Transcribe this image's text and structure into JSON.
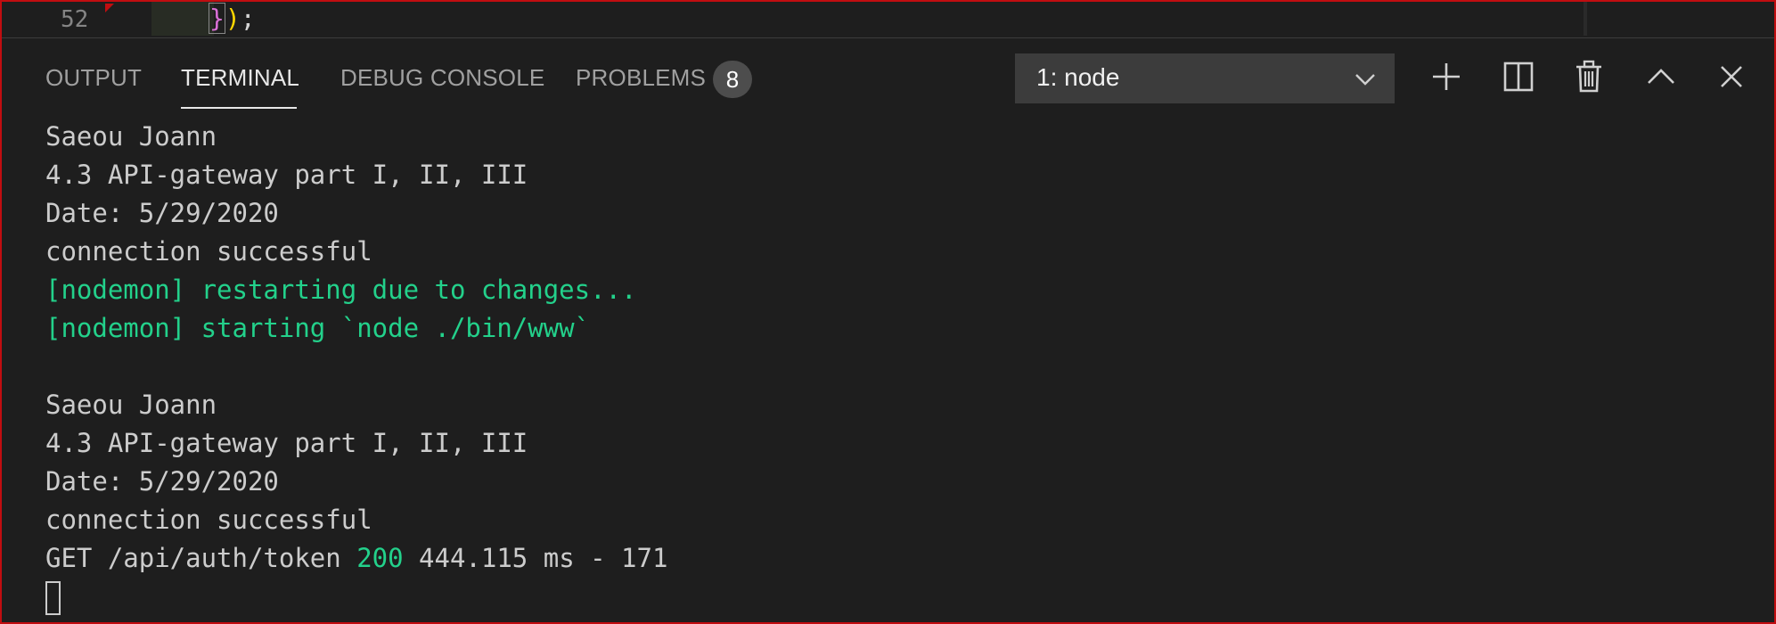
{
  "editor": {
    "line_number": "52",
    "code_brace": "}",
    "code_paren": ")",
    "code_rest": ";"
  },
  "panel": {
    "tabs": [
      {
        "label": "OUTPUT",
        "active": false
      },
      {
        "label": "TERMINAL",
        "active": true
      },
      {
        "label": "DEBUG CONSOLE",
        "active": false
      },
      {
        "label": "PROBLEMS",
        "active": false
      }
    ],
    "problems_count": "8",
    "terminal_select": "1: node",
    "actions": [
      "plus-icon",
      "split-icon",
      "trash-icon",
      "chevron-up-icon",
      "close-icon"
    ]
  },
  "terminal": {
    "lines": [
      {
        "text": "Saeou Joann",
        "color": "default"
      },
      {
        "text": "4.3 API-gateway part I, II, III",
        "color": "default"
      },
      {
        "text": "Date: 5/29/2020",
        "color": "default"
      },
      {
        "text": "connection successful",
        "color": "default"
      },
      {
        "text": "[nodemon] restarting due to changes...",
        "color": "green"
      },
      {
        "text": "[nodemon] starting `node ./bin/www`",
        "color": "green"
      },
      {
        "text": "",
        "color": "default"
      },
      {
        "text": "Saeou Joann",
        "color": "default"
      },
      {
        "text": "4.3 API-gateway part I, II, III",
        "color": "default"
      },
      {
        "text": "Date: 5/29/2020",
        "color": "default"
      },
      {
        "text": "connection successful",
        "color": "default"
      }
    ],
    "request_line": {
      "prefix": "GET /api/auth/token ",
      "status": "200",
      "suffix": " 444.115 ms - 171"
    }
  },
  "colors": {
    "background": "#1e1e1e",
    "green": "#23d18b",
    "text": "#cccccc",
    "border": "#c10d10"
  }
}
